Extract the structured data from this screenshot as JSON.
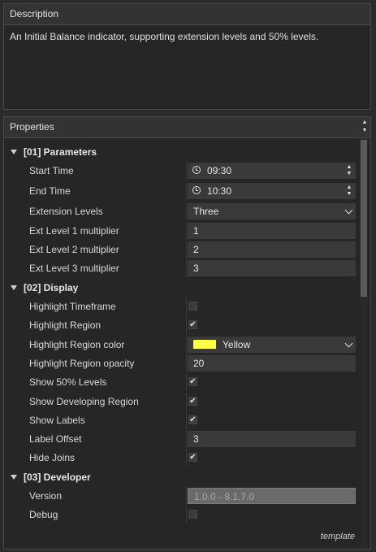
{
  "description": {
    "header": "Description",
    "text": "An Initial Balance indicator, supporting extension levels and 50% levels."
  },
  "properties": {
    "header": "Properties",
    "categories": [
      {
        "label": "[01] Parameters"
      },
      {
        "label": "[02] Display"
      },
      {
        "label": "[03] Developer"
      }
    ],
    "rows": {
      "start_time": {
        "name": "Start Time",
        "value": "09:30"
      },
      "end_time": {
        "name": "End Time",
        "value": "10:30"
      },
      "extension_levels": {
        "name": "Extension Levels",
        "value": "Three"
      },
      "ext1": {
        "name": "Ext Level 1 multiplier",
        "value": "1"
      },
      "ext2": {
        "name": "Ext Level 2 multiplier",
        "value": "2"
      },
      "ext3": {
        "name": "Ext Level 3 multiplier",
        "value": "3"
      },
      "highlight_timeframe": {
        "name": "Highlight Timeframe",
        "checked": false
      },
      "highlight_region": {
        "name": "Highlight Region",
        "checked": true,
        "mark": "✔"
      },
      "highlight_color": {
        "name": "Highlight Region color",
        "value": "Yellow",
        "color": "#ffff4a"
      },
      "highlight_opacity": {
        "name": "Highlight Region opacity",
        "value": "20"
      },
      "show_50": {
        "name": "Show 50% Levels",
        "checked": true,
        "mark": "✔"
      },
      "show_developing": {
        "name": "Show Developing Region",
        "checked": true,
        "mark": "✔"
      },
      "show_labels": {
        "name": "Show Labels",
        "checked": true,
        "mark": "✔"
      },
      "label_offset": {
        "name": "Label Offset",
        "value": "3"
      },
      "hide_joins": {
        "name": "Hide Joins",
        "checked": true,
        "mark": "✔"
      },
      "version": {
        "name": "Version",
        "value": "1.0.0 - 8.1.7.0"
      },
      "debug": {
        "name": "Debug",
        "checked": false
      }
    },
    "footer": "template"
  }
}
